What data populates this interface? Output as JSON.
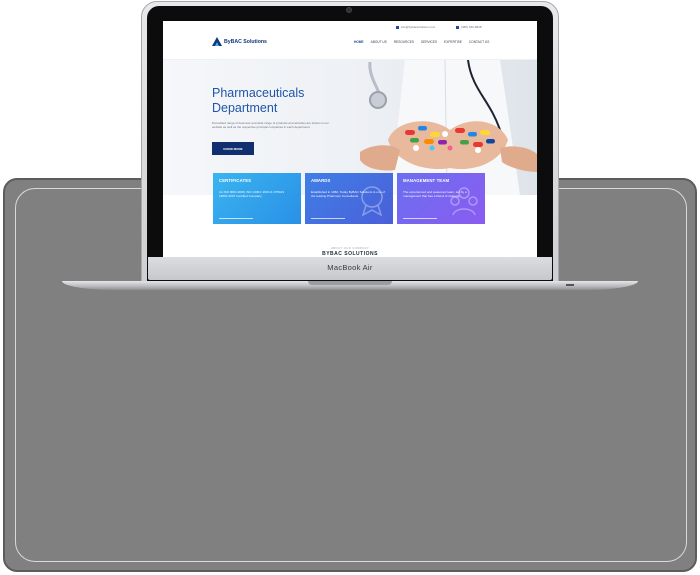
{
  "device": {
    "label": "MacBook Air"
  },
  "site": {
    "topbar": {
      "email": "info@bybacsolutions.com",
      "phone": "(480) 940-9848"
    },
    "brand": {
      "name": "ByBAC Solutions",
      "color": "#12357a"
    },
    "nav": [
      "HOME",
      "ABOUT US",
      "RESOURCES",
      "SERVICES",
      "EXPERTISE",
      "CONTACT US"
    ],
    "hero": {
      "title_line1": "Pharmaceuticals",
      "title_line2": "Department",
      "description": "Diversified range of business and wide range of products and activities are shown in our website as well as the respective principal companies in each department.",
      "button": "KNOW MORE"
    },
    "cards": [
      {
        "title": "CERTIFICATES",
        "text": "An ISO 9001:2008, ISO 14001: 2004 & OHSAS 18001:2007 Certified Company",
        "color": "#2a90e6"
      },
      {
        "title": "AWARDS",
        "text": "Established in 1982, Today ByBAC Solutions is one of the leading Pharmacy Consultants",
        "color": "#4b5fd9"
      },
      {
        "title": "MANAGEMENT TEAM",
        "text": "The experienced and seasoned team, led by a management that has a blend of strategic",
        "color": "#8b5cf0"
      }
    ],
    "about": {
      "eyebrow": "ABOUT OUR COMPANY",
      "heading": "BYBAC SOLUTIONS"
    }
  }
}
